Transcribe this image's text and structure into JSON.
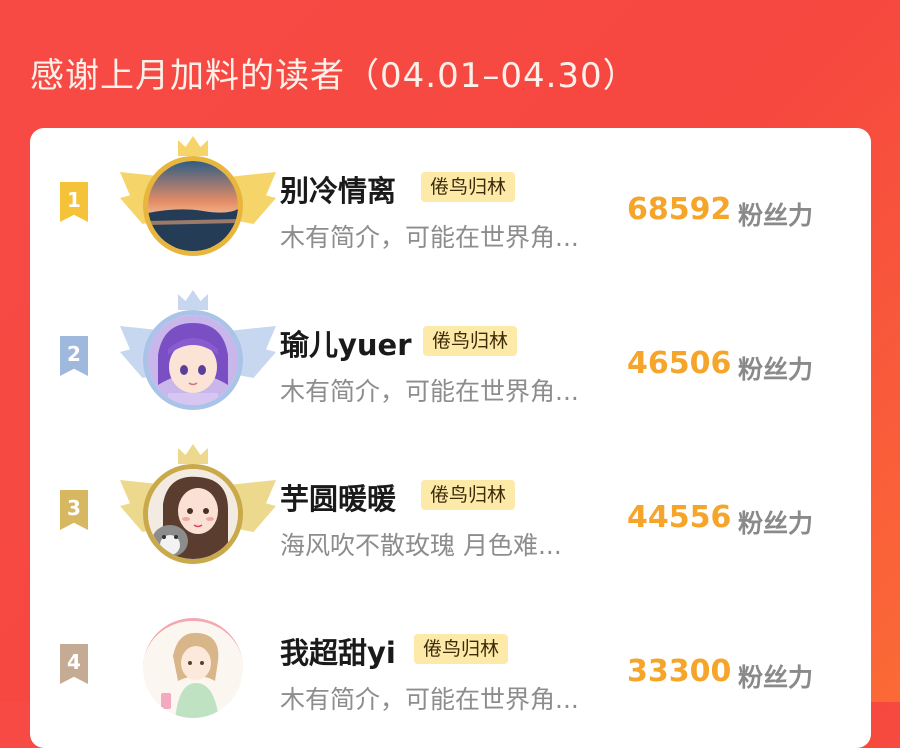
{
  "header": {
    "title": "感谢上月加料的读者（04.01–04.30）"
  },
  "score_unit": "粉丝力",
  "readers": [
    {
      "rank": "1",
      "name": "别冷情离",
      "tag": "倦鸟归林",
      "bio": "木有简介，可能在世界角...",
      "score": "68592",
      "badge_color": "#f4c33a",
      "wing_color": "#f5d56a",
      "avatar_icon": "sunset-avatar"
    },
    {
      "rank": "2",
      "name": "瑜儿yuer",
      "tag": "倦鸟归林",
      "bio": "木有简介，可能在世界角...",
      "score": "46506",
      "badge_color": "#9fb8dd",
      "wing_color": "#c7d7ef",
      "avatar_icon": "anime-avatar"
    },
    {
      "rank": "3",
      "name": "芋圆暖暖",
      "tag": "倦鸟归林",
      "bio": "海风吹不散玫瑰 月色难...",
      "score": "44556",
      "badge_color": "#d7b860",
      "wing_color": "#ecd98d",
      "avatar_icon": "girl-cat-avatar"
    },
    {
      "rank": "4",
      "name": "我超甜yi",
      "tag": "倦鸟归林",
      "bio": "木有简介，可能在世界角...",
      "score": "33300",
      "badge_color": "#c5ab94",
      "wing_color": "",
      "avatar_icon": "drawn-girl-avatar"
    }
  ]
}
